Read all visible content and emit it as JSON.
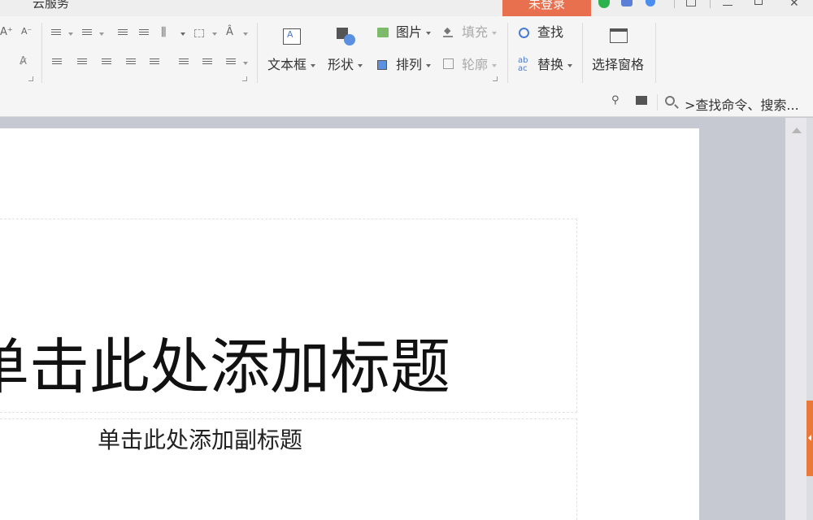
{
  "topbar": {
    "cloud_service": "云服务",
    "login_button": "未登录"
  },
  "ribbon": {
    "font": {
      "grow_glyph": "A⁺",
      "shrink_glyph": "A⁻"
    },
    "insert": {
      "textbox_label": "文本框",
      "shape_label": "形状",
      "picture_label": "图片",
      "arrange_label": "排列",
      "fill_label": "填充",
      "outline_label": "轮廓"
    },
    "edit": {
      "find_label": "查找",
      "replace_label": "替换",
      "selection_pane_label": "选择窗格"
    },
    "command_search": ">查找命令、搜索..."
  },
  "slide": {
    "title_placeholder": "单击此处添加标题",
    "subtitle_placeholder": "单击此处添加副标题"
  },
  "colors": {
    "accent_orange": "#e8704f",
    "workspace_bg": "#c6c9d2"
  }
}
